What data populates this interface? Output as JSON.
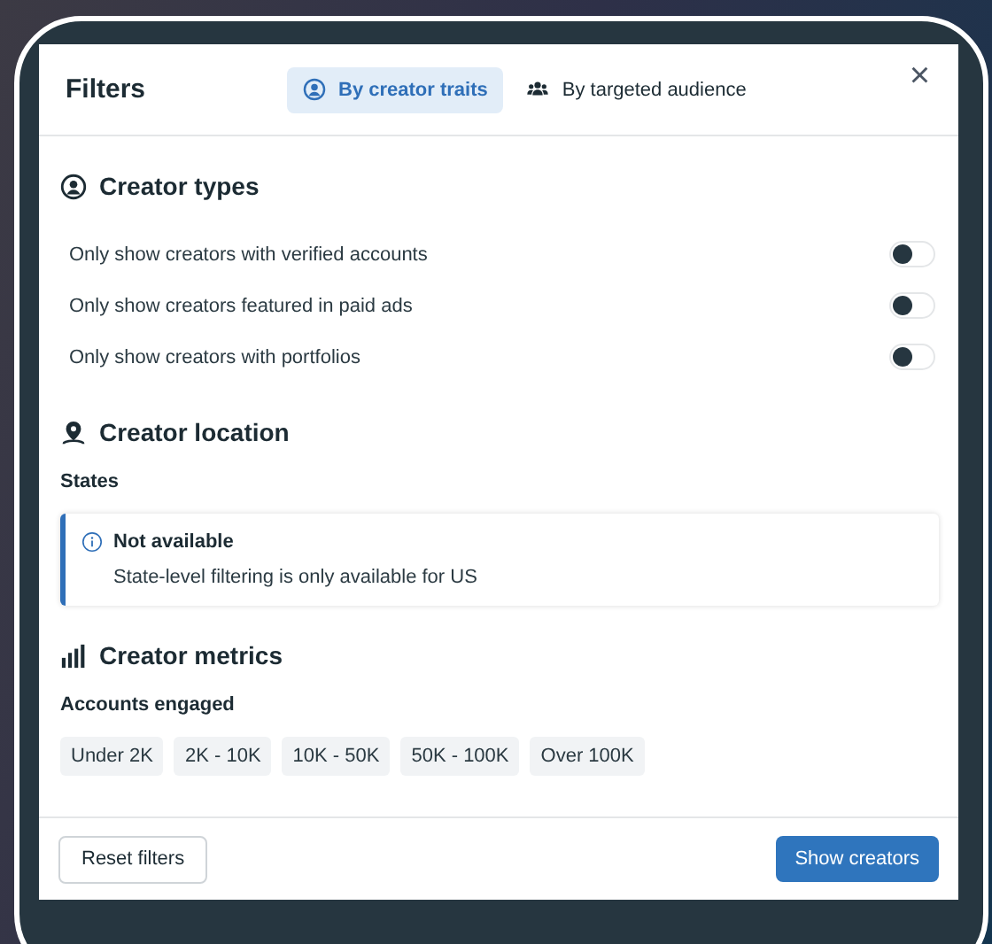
{
  "dialog": {
    "title": "Filters",
    "close": "×"
  },
  "tabs": [
    {
      "label": "By creator traits",
      "selected": true
    },
    {
      "label": "By targeted audience",
      "selected": false
    }
  ],
  "sections": [
    {
      "kind": "toggles",
      "title": "Creator types",
      "items": [
        {
          "label": "Only show creators with verified accounts",
          "on": false
        },
        {
          "label": "Only show creators featured in paid ads",
          "on": false
        },
        {
          "label": "Only show creators with portfolios",
          "on": false
        }
      ]
    },
    {
      "kind": "notice",
      "title": "Creator location",
      "subtitle": "States",
      "notice": {
        "title": "Not available",
        "text": "State-level filtering is only available for US"
      }
    },
    {
      "kind": "chips",
      "title": "Creator metrics",
      "subtitle": "Accounts engaged",
      "chips": [
        {
          "label": "Under 2K",
          "selected": false
        },
        {
          "label": "2K - 10K",
          "selected": false
        },
        {
          "label": "10K - 50K",
          "selected": false
        },
        {
          "label": "50K - 100K",
          "selected": false
        },
        {
          "label": "Over 100K",
          "selected": false
        }
      ]
    }
  ],
  "footer": {
    "reset": "Reset filters",
    "submit": "Show creators"
  }
}
